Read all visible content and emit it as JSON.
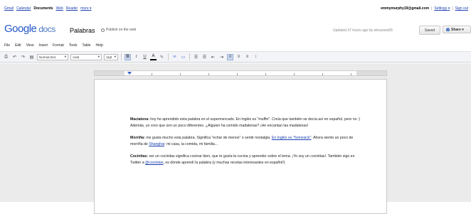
{
  "gnav": {
    "items": [
      "Gmail",
      "Calendar",
      "Documents",
      "Web",
      "Reader",
      "more ▾"
    ],
    "current": 2
  },
  "account": {
    "email": "emmymurphy19@gmail.com",
    "settings": "Settings ▾",
    "signout": "Sign out"
  },
  "header": {
    "logo_google": "Google",
    "logo_docs": "docs",
    "doc_title": "Palabras",
    "publish_label": "Publish on the web",
    "updated": "Updated 37 hours ago by elmurano05",
    "save": "Saved",
    "share": "Share ▾"
  },
  "menu": [
    "File",
    "Edit",
    "View",
    "Insert",
    "Format",
    "Tools",
    "Table",
    "Help"
  ],
  "toolbar": {
    "style": "Normal text",
    "font": "Arial",
    "size": "11pt"
  },
  "document": {
    "p1": {
      "term": "Maciatena:",
      "text": " hoy he aprendido esta palabra en el supermercado. En Inglés es \"muffin\". Creía que también se decía así en español, pero no :) Además, yo creo que son un poco diferentes. ¿Alguien ha comido madalenas? ¡He encantan las madalenas!"
    },
    "p2": {
      "term": "Morriña:",
      "text_a": " me gusta mucho esta palabra. Significa \"echar de menos\" o sentir nostalgia. ",
      "link": "En Inglés es \"homesick\"",
      "text_b": ". Ahora siento un poco de morriña de ",
      "link2": "Shanghai",
      "text_c": ": mi casa, la comida, mi familia..."
    },
    "p3": {
      "term": "Cocinitas:",
      "text_a": " ser un cocinitas significa cocinar bien, que te gusta la cocina y aprender sobre el tema. ¡Yo soy un cocinitas!. También sigo en Twitter a ",
      "link": "@cocinitas",
      "text_b": ", es dónde aprendí la palabra (y muchas recetas interesantes en español!)"
    }
  }
}
